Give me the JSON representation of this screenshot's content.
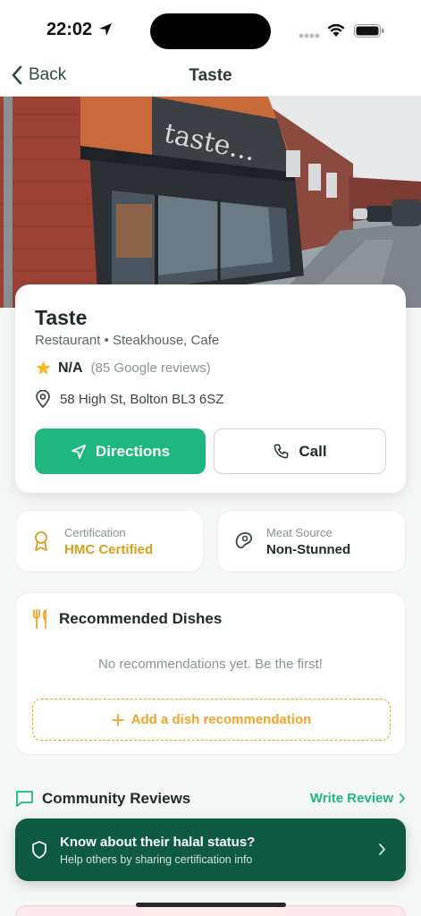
{
  "status_bar": {
    "time": "22:02"
  },
  "nav": {
    "back_label": "Back",
    "title": "Taste"
  },
  "hero": {
    "sign_text": "taste..."
  },
  "place": {
    "name": "Taste",
    "category": "Restaurant • Steakhouse, Cafe",
    "rating": "N/A",
    "review_count": "(85 Google reviews)",
    "address": "58 High St, Bolton BL3 6SZ"
  },
  "actions": {
    "directions_label": "Directions",
    "call_label": "Call"
  },
  "certification": {
    "label": "Certification",
    "value": "HMC Certified"
  },
  "meat_source": {
    "label": "Meat Source",
    "value": "Non-Stunned"
  },
  "dishes": {
    "title": "Recommended Dishes",
    "empty_text": "No recommendations yet. Be the first!",
    "add_label": "Add a dish recommendation"
  },
  "reviews": {
    "title": "Community Reviews",
    "write_label": "Write Review"
  },
  "halal_banner": {
    "title": "Know about their halal status?",
    "subtitle": "Help others by sharing certification info"
  },
  "colors": {
    "accent_green": "#1fb77f",
    "dark_green": "#0f5a42",
    "gold": "#d4a020",
    "orange": "#f0a52a"
  },
  "icons": [
    "location-arrow-icon",
    "wifi-icon",
    "battery-icon",
    "chevron-left-icon",
    "star-icon",
    "map-pin-icon",
    "navigation-icon",
    "phone-icon",
    "award-icon",
    "steak-icon",
    "utensils-icon",
    "plus-icon",
    "chat-bubble-icon",
    "chevron-right-icon",
    "shield-icon"
  ]
}
